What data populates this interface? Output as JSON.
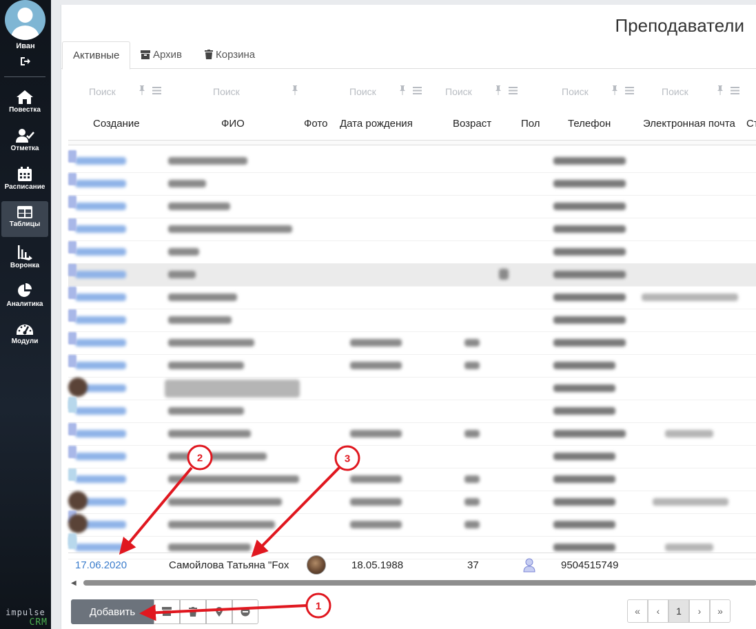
{
  "user": {
    "name": "Иван"
  },
  "nav": [
    {
      "label": "Повестка",
      "icon": "home-icon"
    },
    {
      "label": "Отметка",
      "icon": "user-check-icon"
    },
    {
      "label": "Расписание",
      "icon": "calendar-icon"
    },
    {
      "label": "Таблицы",
      "icon": "table-icon",
      "active": true
    },
    {
      "label": "Воронка",
      "icon": "funnel-icon"
    },
    {
      "label": "Аналитика",
      "icon": "pie-chart-icon"
    },
    {
      "label": "Модули",
      "icon": "gauge-icon"
    }
  ],
  "brand": {
    "line1": "impulse",
    "line2": "CRM"
  },
  "page": {
    "title": "Преподаватели"
  },
  "tabs": [
    {
      "label": "Активные",
      "active": true
    },
    {
      "label": "Архив",
      "icon": "archive-icon"
    },
    {
      "label": "Корзина",
      "icon": "trash-icon"
    }
  ],
  "filters": {
    "placeholder": "Поиск"
  },
  "columns": [
    "Создание",
    "ФИО",
    "Фото",
    "Дата рождения",
    "Возраст",
    "Пол",
    "Телефон",
    "Электронная почта",
    "Ст"
  ],
  "last_row": {
    "created": "17.06.2020",
    "name": "Самойлова Татьяна \"Fox",
    "birth_date": "18.05.1988",
    "age": "37",
    "phone": "9504515749"
  },
  "footer": {
    "add_label": "Добавить",
    "tools": [
      "archive-icon",
      "trash-icon",
      "pin-icon",
      "circle-icon"
    ],
    "pagination": [
      "«",
      "‹",
      "1",
      "›",
      "»"
    ],
    "current_page": "1"
  },
  "annotations": [
    "1",
    "2",
    "3"
  ],
  "colors": {
    "link": "#3a7ccc",
    "annotation": "#e0171f",
    "sidebar": "#151c26",
    "button": "#6c737c"
  }
}
